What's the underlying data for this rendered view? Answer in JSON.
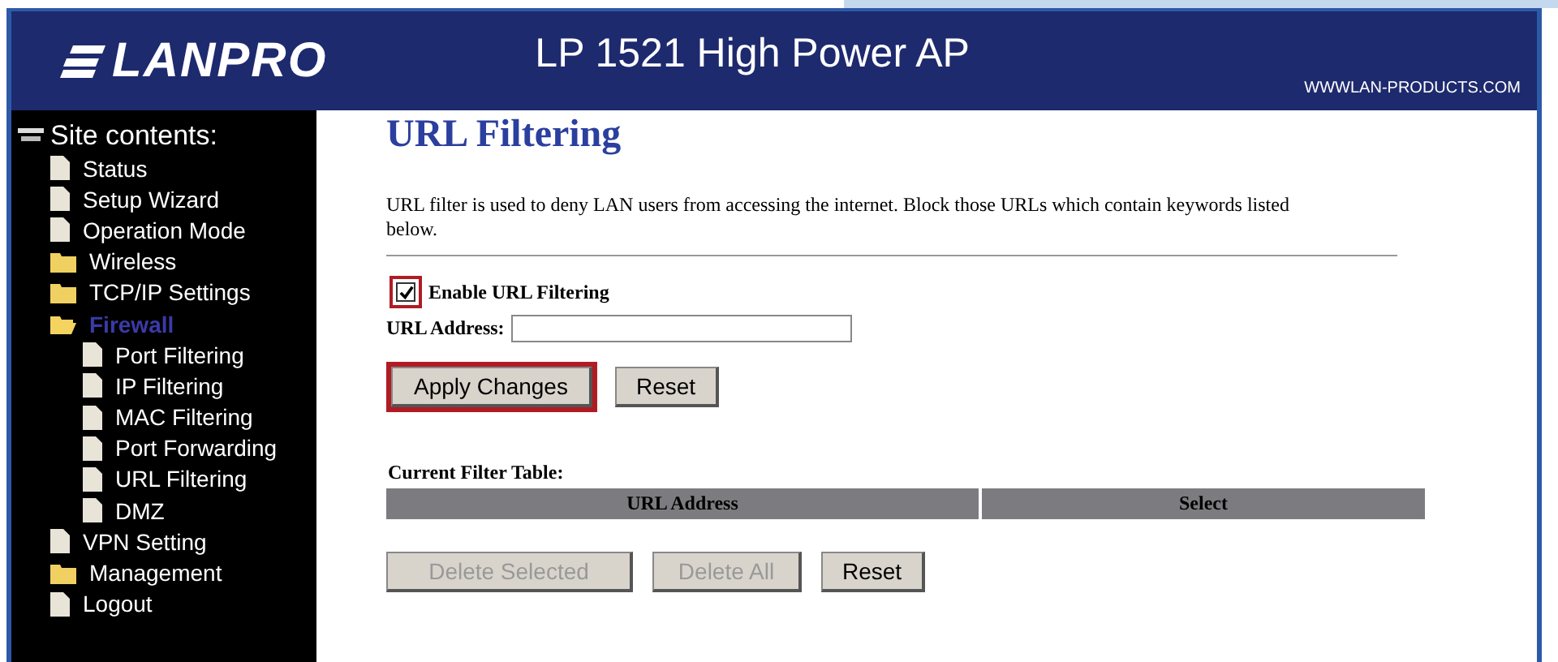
{
  "header": {
    "logo": "LANPRO",
    "title": "LP 1521 High Power AP",
    "website": "WWWLAN-PRODUCTS.COM"
  },
  "sidebar": {
    "title": "Site contents:",
    "items": [
      {
        "label": "Status",
        "kind": "page",
        "selected": false
      },
      {
        "label": "Setup Wizard",
        "kind": "page",
        "selected": false
      },
      {
        "label": "Operation Mode",
        "kind": "page",
        "selected": false
      },
      {
        "label": "Wireless",
        "kind": "folder",
        "selected": false,
        "expanded": false
      },
      {
        "label": "TCP/IP Settings",
        "kind": "folder",
        "selected": false,
        "expanded": false
      },
      {
        "label": "Firewall",
        "kind": "folder",
        "selected": true,
        "expanded": true,
        "children": [
          {
            "label": "Port Filtering",
            "kind": "page",
            "selected": false
          },
          {
            "label": "IP Filtering",
            "kind": "page",
            "selected": false
          },
          {
            "label": "MAC Filtering",
            "kind": "page",
            "selected": false
          },
          {
            "label": "Port Forwarding",
            "kind": "page",
            "selected": false
          },
          {
            "label": "URL Filtering",
            "kind": "page",
            "selected": false
          },
          {
            "label": "DMZ",
            "kind": "page",
            "selected": false
          }
        ]
      },
      {
        "label": "VPN Setting",
        "kind": "page",
        "selected": false
      },
      {
        "label": "Management",
        "kind": "folder",
        "selected": false,
        "expanded": false
      },
      {
        "label": "Logout",
        "kind": "page",
        "selected": false
      }
    ]
  },
  "content": {
    "title": "URL Filtering",
    "description": "URL filter is used to deny LAN users from accessing the internet. Block those URLs which contain keywords listed below.",
    "enable": {
      "label": "Enable URL Filtering",
      "checked": true,
      "highlighted": true
    },
    "url_field": {
      "label": "URL Address:"
    },
    "form_buttons": [
      {
        "label": "Apply Changes",
        "highlighted": true,
        "disabled": false
      },
      {
        "label": "Reset",
        "highlighted": false,
        "disabled": false
      }
    ],
    "table": {
      "title": "Current Filter Table:",
      "columns": [
        "URL Address",
        "Select"
      ]
    },
    "table_buttons": [
      {
        "label": "Delete Selected",
        "disabled": true
      },
      {
        "label": "Delete All",
        "disabled": true
      },
      {
        "label": "Reset",
        "disabled": false
      }
    ]
  }
}
